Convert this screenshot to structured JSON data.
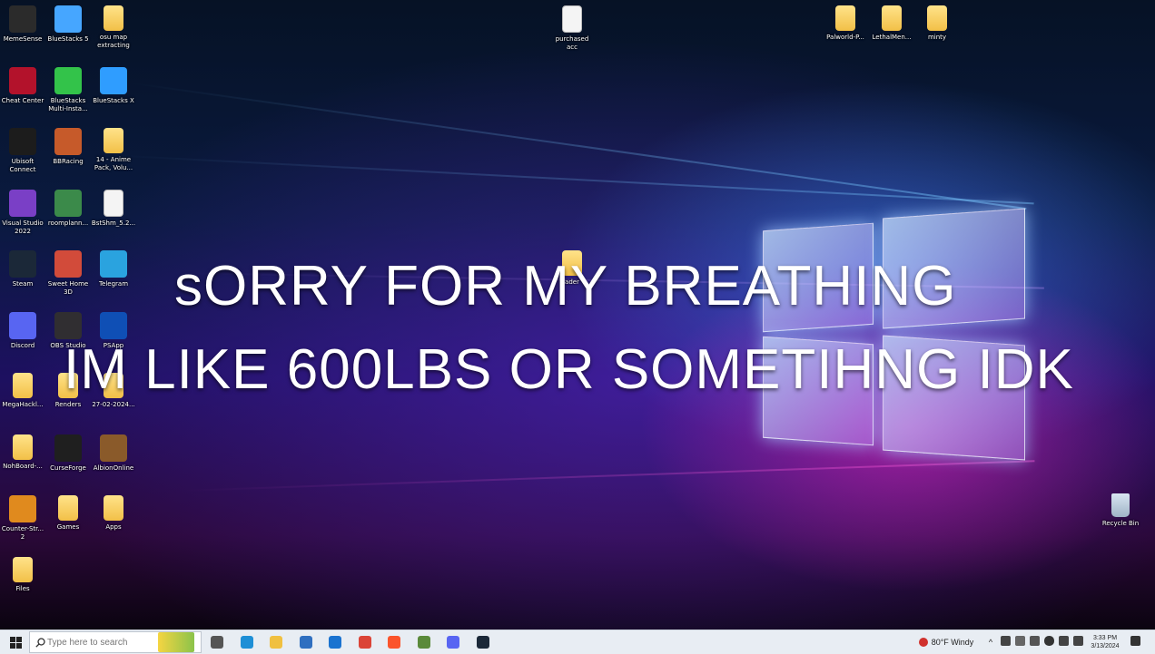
{
  "overlay": {
    "line1": "sORRY FOR MY BREATHING",
    "line2": "IM LIKE 600LBS OR SOMETIHNG IDK"
  },
  "desktop_icons": [
    {
      "label": "MemeSense",
      "icon": "memesense-app-icon",
      "type": "app",
      "color": "#2b2b2b"
    },
    {
      "label": "BlueStacks 5",
      "icon": "bluestacks-app-icon",
      "type": "app",
      "color": "#46a6ff"
    },
    {
      "label": "osu map extracting",
      "icon": "folder-icon",
      "type": "folder"
    },
    {
      "label": "Cheat Center",
      "icon": "cheat-center-app-icon",
      "type": "app",
      "color": "#b3122b"
    },
    {
      "label": "BlueStacks Multi-Insta...",
      "icon": "bluestacks-multi-app-icon",
      "type": "app",
      "color": "#33c34a"
    },
    {
      "label": "BlueStacks X",
      "icon": "bluestacks-x-app-icon",
      "type": "app",
      "color": "#2f9dff"
    },
    {
      "label": "Ubisoft Connect",
      "icon": "ubisoft-app-icon",
      "type": "app",
      "color": "#1c1c1c"
    },
    {
      "label": "BBRacing",
      "icon": "bbracing-app-icon",
      "type": "app",
      "color": "#c65a2a"
    },
    {
      "label": "14 - Anime Pack, Volu...",
      "icon": "folder-icon",
      "type": "folder"
    },
    {
      "label": "Visual Studio 2022",
      "icon": "visual-studio-app-icon",
      "type": "app",
      "color": "#7a3fc6"
    },
    {
      "label": "roomplann...",
      "icon": "roomplanner-app-icon",
      "type": "app",
      "color": "#3b8a4a"
    },
    {
      "label": "BstShm_5.2...",
      "icon": "file-icon",
      "type": "file"
    },
    {
      "label": "Steam",
      "icon": "steam-app-icon",
      "type": "app",
      "color": "#1b2838"
    },
    {
      "label": "Sweet Home 3D",
      "icon": "sweet-home-app-icon",
      "type": "app",
      "color": "#d24b3a"
    },
    {
      "label": "Telegram",
      "icon": "telegram-app-icon",
      "type": "app",
      "color": "#2aa3df"
    },
    {
      "label": "Discord",
      "icon": "discord-app-icon",
      "type": "app",
      "color": "#5865f2"
    },
    {
      "label": "OBS Studio",
      "icon": "obs-app-icon",
      "type": "app",
      "color": "#302e31"
    },
    {
      "label": "PSApp",
      "icon": "playstation-app-icon",
      "type": "app",
      "color": "#0f4fb5"
    },
    {
      "label": "MegaHackl...",
      "icon": "folder-icon",
      "type": "folder"
    },
    {
      "label": "Renders",
      "icon": "folder-icon",
      "type": "folder"
    },
    {
      "label": "27-02-2024...",
      "icon": "folder-icon",
      "type": "folder"
    },
    {
      "label": "NohBoard-...",
      "icon": "folder-icon",
      "type": "folder"
    },
    {
      "label": "CurseForge",
      "icon": "curseforge-app-icon",
      "type": "app",
      "color": "#1f1f1f"
    },
    {
      "label": "AlbionOnline",
      "icon": "albion-app-icon",
      "type": "app",
      "color": "#8a5a2a"
    },
    {
      "label": "Counter-Str... 2",
      "icon": "counter-strike-app-icon",
      "type": "app",
      "color": "#e08a1e"
    },
    {
      "label": "Games",
      "icon": "folder-icon",
      "type": "folder"
    },
    {
      "label": "Apps",
      "icon": "folder-icon",
      "type": "folder"
    },
    {
      "label": "Files",
      "icon": "folder-icon",
      "type": "folder"
    }
  ],
  "top_icons": [
    {
      "label": "purchased acc",
      "icon": "file-icon",
      "type": "file"
    },
    {
      "label": "Palworld-P...",
      "icon": "folder-icon",
      "type": "folder"
    },
    {
      "label": "LethalMen...",
      "icon": "folder-icon",
      "type": "folder"
    },
    {
      "label": "minty",
      "icon": "folder-icon",
      "type": "folder"
    }
  ],
  "center_icon": {
    "label": "ader",
    "icon": "folder-icon"
  },
  "recycle_bin": {
    "label": "Recycle Bin",
    "icon": "recycle-bin-icon"
  },
  "taskbar": {
    "search_placeholder": "Type here to search",
    "weather": "80°F  Windy",
    "time": "3:33 PM",
    "date": "3/13/2024",
    "apps": [
      {
        "icon": "task-view-icon",
        "color": "#555"
      },
      {
        "icon": "edge-icon",
        "color": "#1e8fd6"
      },
      {
        "icon": "file-explorer-icon",
        "color": "#f0c040"
      },
      {
        "icon": "app-icon-blue",
        "color": "#2f6fc0"
      },
      {
        "icon": "mail-icon",
        "color": "#1a73d0"
      },
      {
        "icon": "chrome-icon",
        "color": "#db4437"
      },
      {
        "icon": "brave-icon",
        "color": "#fb542b"
      },
      {
        "icon": "game-app-icon",
        "color": "#5a8a3a"
      },
      {
        "icon": "discord-taskbar-icon",
        "color": "#5865f2"
      },
      {
        "icon": "steam-taskbar-icon",
        "color": "#1b2838"
      }
    ]
  }
}
